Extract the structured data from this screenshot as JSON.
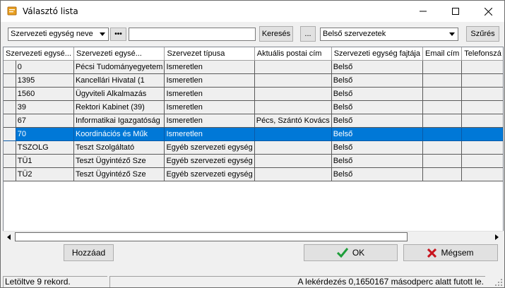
{
  "window": {
    "title": "Választó lista"
  },
  "toolbar": {
    "field_select": "Szervezeti egység neve",
    "more_label": "•••",
    "search_value": "",
    "search_button": "Keresés",
    "ellipsis_button": "...",
    "filter_select": "Belső szervezetek",
    "filter_button": "Szűrés"
  },
  "grid": {
    "columns": [
      "Szervezeti egysé...",
      "Szervezeti egysé...",
      "Szervezet típusa",
      "Aktuális postai cím",
      "Szervezeti egység fajtája",
      "Email cím",
      "Telefonszá"
    ],
    "rows": [
      [
        "0",
        "Pécsi Tudományegyetem",
        "Ismeretlen",
        "",
        "Belső",
        "",
        ""
      ],
      [
        "1395",
        "Kancellári Hivatal (1",
        "Ismeretlen",
        "",
        "Belső",
        "",
        ""
      ],
      [
        "1560",
        "Ügyviteli Alkalmazás",
        "Ismeretlen",
        "",
        "Belső",
        "",
        ""
      ],
      [
        "39",
        "Rektori Kabinet (39)",
        "Ismeretlen",
        "",
        "Belső",
        "",
        ""
      ],
      [
        "67",
        "Informatikai Igazgatóság",
        "Ismeretlen",
        "Pécs, Szántó Kovács",
        "Belső",
        "",
        ""
      ],
      [
        "70",
        "Koordinációs és Műk",
        "Ismeretlen",
        "",
        "Belső",
        "",
        ""
      ],
      [
        "TSZOLG",
        "Teszt Szolgáltató",
        "Egyéb szervezeti egység",
        "",
        "Belső",
        "",
        ""
      ],
      [
        "TÜ1",
        "Teszt Ügyintéző Sze",
        "Egyéb szervezeti egység",
        "",
        "Belső",
        "",
        ""
      ],
      [
        "TÜ2",
        "Teszt Ügyintéző Sze",
        "Egyéb szervezeti egység",
        "",
        "Belső",
        "",
        ""
      ]
    ],
    "selected_row": 5
  },
  "buttons": {
    "add": "Hozzáad",
    "ok": "OK",
    "cancel": "Mégsem"
  },
  "status": {
    "left": "Letöltve 9 rekord.",
    "right": "A lekérdezés 0,1650167 másodperc alatt futott le."
  },
  "colors": {
    "selection": "#0078d7",
    "ok_check": "#1e9e3a",
    "cancel_x": "#c8141e",
    "icon": "#e8a020"
  }
}
